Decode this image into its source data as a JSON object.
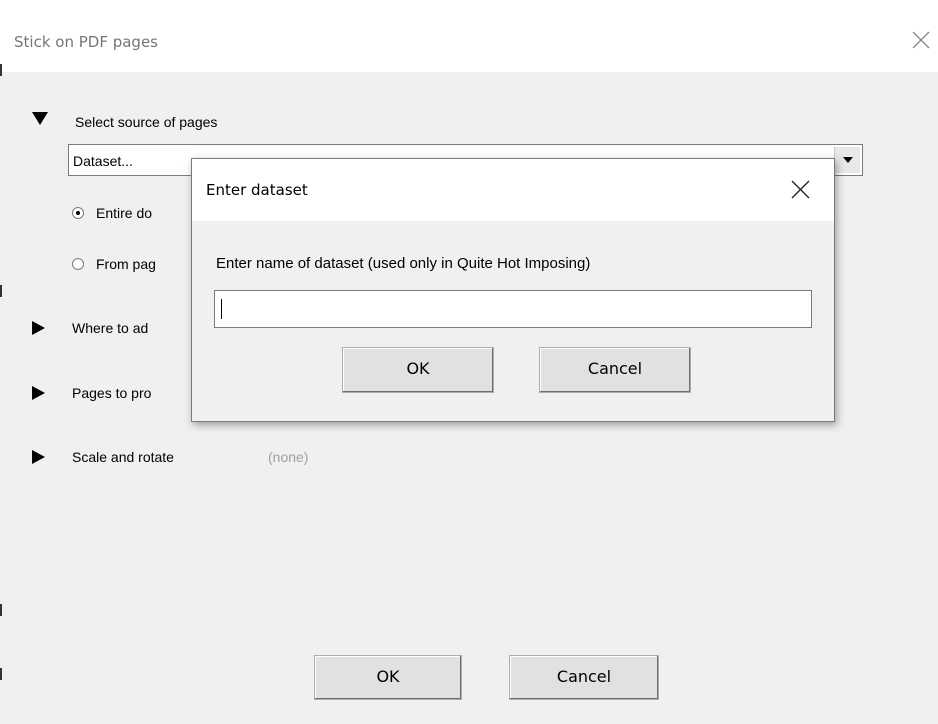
{
  "window": {
    "title": "Stick on PDF pages",
    "close_icon": "close-icon"
  },
  "sections": {
    "source": {
      "label": "Select source of pages",
      "expanded": true
    },
    "where": {
      "label": "Where to ad",
      "expanded": false
    },
    "pages": {
      "label": "Pages to pro",
      "expanded": false
    },
    "scale": {
      "label": "Scale and rotate",
      "value": "(none)",
      "expanded": false
    }
  },
  "source_combo": {
    "value": "Dataset..."
  },
  "radios": [
    {
      "label": "Entire do",
      "selected": true
    },
    {
      "label": "From pag",
      "selected": false
    }
  ],
  "footer": {
    "ok_label": "OK",
    "cancel_label": "Cancel"
  },
  "dialog": {
    "title": "Enter dataset",
    "prompt": "Enter name of dataset (used only in Quite Hot Imposing)",
    "input_value": "",
    "ok_label": "OK",
    "cancel_label": "Cancel"
  },
  "colors": {
    "background": "#f0f0f0",
    "titlebar": "#ffffff",
    "title_text": "#767676"
  }
}
